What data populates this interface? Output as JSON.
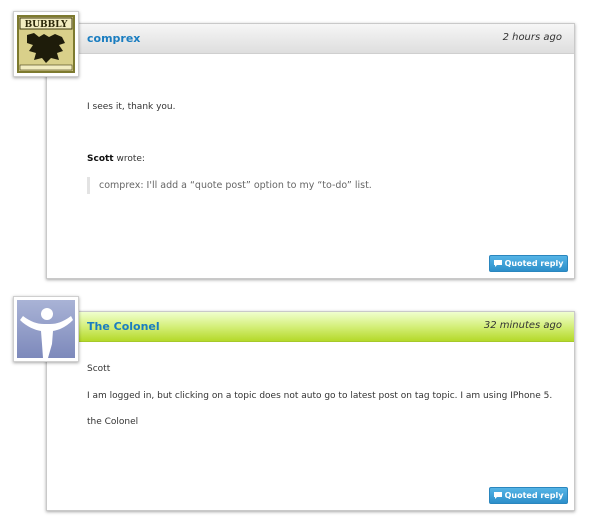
{
  "posts": [
    {
      "author": "comprex",
      "time": "2 hours ago",
      "avatar_text": "BUBBLY",
      "lines": [
        "I sees it, thank you."
      ],
      "quote_author": "Scott",
      "quote_wrote": "wrote:",
      "quote_text": "comprex: I'll add a “quote post” option to my “to-do” list.",
      "reply_label": "Quoted reply"
    },
    {
      "author": "The Colonel",
      "time": "32 minutes ago",
      "lines": [
        "Scott",
        "I am logged in, but clicking on a topic does not auto go to latest post on tag topic.  I am using IPhone 5.",
        "the Colonel"
      ],
      "reply_label": "Quoted reply"
    }
  ],
  "colors": {
    "link": "#1a7dc0",
    "button": "#3a9fd8",
    "header_green": "#b5d92a"
  },
  "icons": {
    "reply": "speech-bubble-icon",
    "avatar_1": "bubbly-crest-avatar",
    "avatar_2": "figure-silhouette-avatar"
  }
}
